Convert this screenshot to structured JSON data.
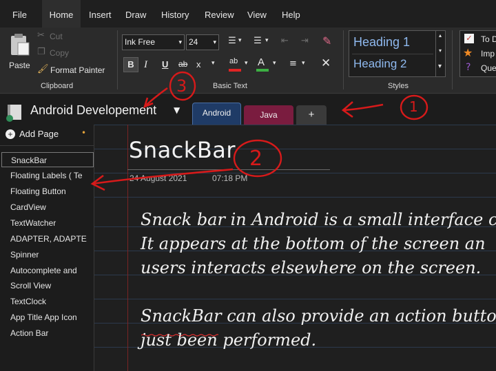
{
  "menu": {
    "items": [
      "File",
      "Home",
      "Insert",
      "Draw",
      "History",
      "Review",
      "View",
      "Help"
    ],
    "active": "Home"
  },
  "ribbon": {
    "clipboard": {
      "paste": "Paste",
      "cut": "Cut",
      "copy": "Copy",
      "format_painter": "Format Painter",
      "label": "Clipboard"
    },
    "basic_text": {
      "font": "Ink Free",
      "size": "24",
      "bold": "B",
      "italic": "I",
      "underline": "U",
      "strike": "ab",
      "subscript": "x",
      "font_color_glyph": "A",
      "label": "Basic Text"
    },
    "styles": {
      "items": [
        "Heading 1",
        "Heading 2"
      ],
      "label": "Styles"
    },
    "tags": {
      "items": [
        "To D",
        "Imp",
        "Que"
      ]
    }
  },
  "notebook": {
    "name": "Android Developement",
    "tabs": [
      {
        "label": "Android",
        "color": "#1f3b66"
      },
      {
        "label": "Java",
        "color": "#7a1c3f"
      },
      {
        "label": "+",
        "color": "#3a3a3a"
      }
    ]
  },
  "pages": {
    "add_label": "Add Page",
    "items": [
      "SnackBar",
      "Floating Labels ( Te",
      "Floating Button",
      "CardView",
      "TextWatcher",
      "ADAPTER, ADAPTE",
      "Spinner",
      "Autocomplete and",
      "Scroll View",
      "TextClock",
      "App Title App Icon",
      "Action Bar"
    ],
    "selected": "SnackBar"
  },
  "note": {
    "title": "SnackBar",
    "date": "24 August 2021",
    "time": "07:18 PM",
    "lines": [
      "Snack bar in Android is a small interface com",
      "It appears at the bottom of the screen an",
      "users interacts  elsewhere on the screen.",
      "SnackBar can also provide an action button",
      "just been performed."
    ]
  },
  "annotations": [
    "1",
    "2",
    "3"
  ],
  "colors": {
    "accent": "#8fb9ef",
    "annotation": "#d71a1a",
    "selection": "#7a7a7a"
  }
}
